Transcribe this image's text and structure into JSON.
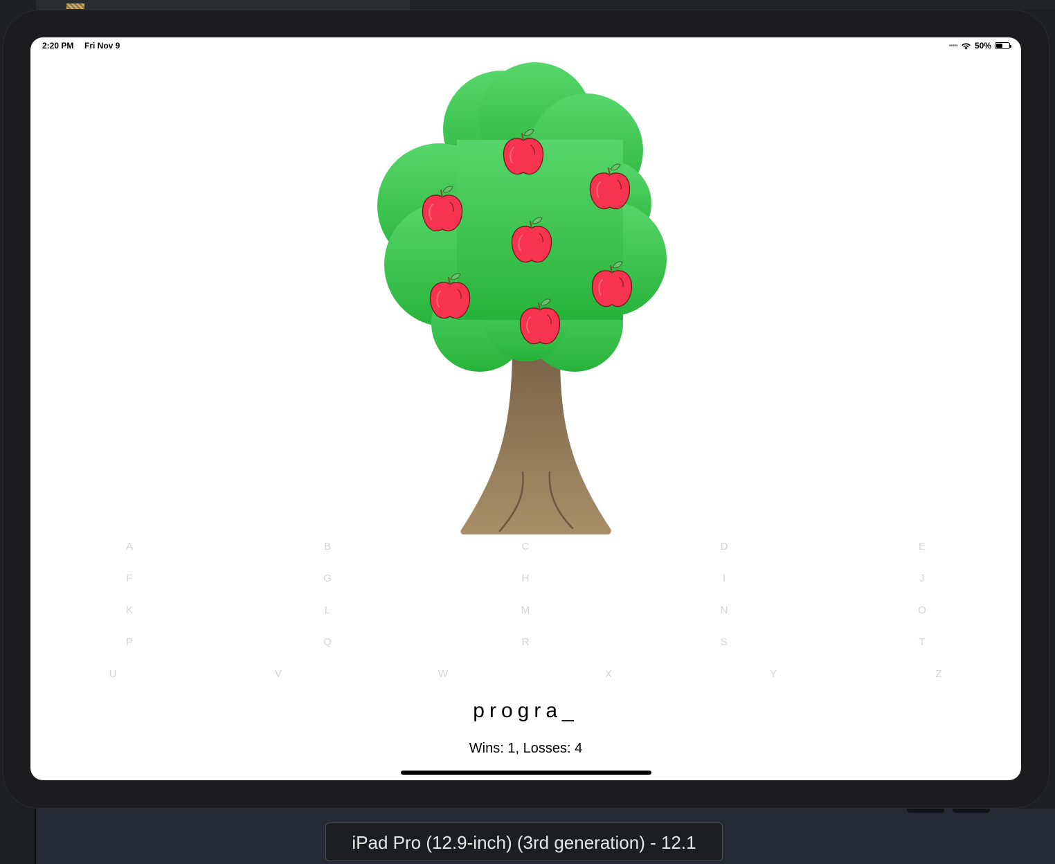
{
  "status_bar": {
    "time": "2:20 PM",
    "date": "Fri Nov 9",
    "battery": "50%",
    "icons": [
      "signal-dots-icon",
      "wifi-icon",
      "battery-icon"
    ]
  },
  "game": {
    "letters": [
      {
        "letter": "A",
        "row": 0,
        "col": 0
      },
      {
        "letter": "B",
        "row": 0,
        "col": 1
      },
      {
        "letter": "C",
        "row": 0,
        "col": 2
      },
      {
        "letter": "D",
        "row": 0,
        "col": 3
      },
      {
        "letter": "E",
        "row": 0,
        "col": 4
      },
      {
        "letter": "F",
        "row": 1,
        "col": 0
      },
      {
        "letter": "G",
        "row": 1,
        "col": 1
      },
      {
        "letter": "H",
        "row": 1,
        "col": 2
      },
      {
        "letter": "I",
        "row": 1,
        "col": 3
      },
      {
        "letter": "J",
        "row": 1,
        "col": 4
      },
      {
        "letter": "K",
        "row": 2,
        "col": 0
      },
      {
        "letter": "L",
        "row": 2,
        "col": 1
      },
      {
        "letter": "M",
        "row": 2,
        "col": 2
      },
      {
        "letter": "N",
        "row": 2,
        "col": 3
      },
      {
        "letter": "O",
        "row": 2,
        "col": 4
      },
      {
        "letter": "P",
        "row": 3,
        "col": 0
      },
      {
        "letter": "Q",
        "row": 3,
        "col": 1
      },
      {
        "letter": "R",
        "row": 3,
        "col": 2
      },
      {
        "letter": "S",
        "row": 3,
        "col": 3
      },
      {
        "letter": "T",
        "row": 3,
        "col": 4
      },
      {
        "letter": "U",
        "row": 4,
        "col": 0
      },
      {
        "letter": "V",
        "row": 4,
        "col": 1
      },
      {
        "letter": "W",
        "row": 4,
        "col": 2
      },
      {
        "letter": "X",
        "row": 4,
        "col": 3
      },
      {
        "letter": "Y",
        "row": 4,
        "col": 4
      },
      {
        "letter": "Z",
        "row": 4,
        "col": 5
      }
    ],
    "word": "progra_",
    "score": "Wins: 1, Losses: 4",
    "apples_remaining": 7
  },
  "colors": {
    "foliage_top": "#57d66b",
    "foliage_bottom": "#27b33a",
    "apple": "#f7344f",
    "trunk_top": "#7a6447",
    "trunk_bottom": "#a88f69",
    "letter_disabled": "#d4d4d6"
  },
  "simulator": {
    "device_label": "iPad Pro (12.9-inch) (3rd generation) - 12.1"
  }
}
